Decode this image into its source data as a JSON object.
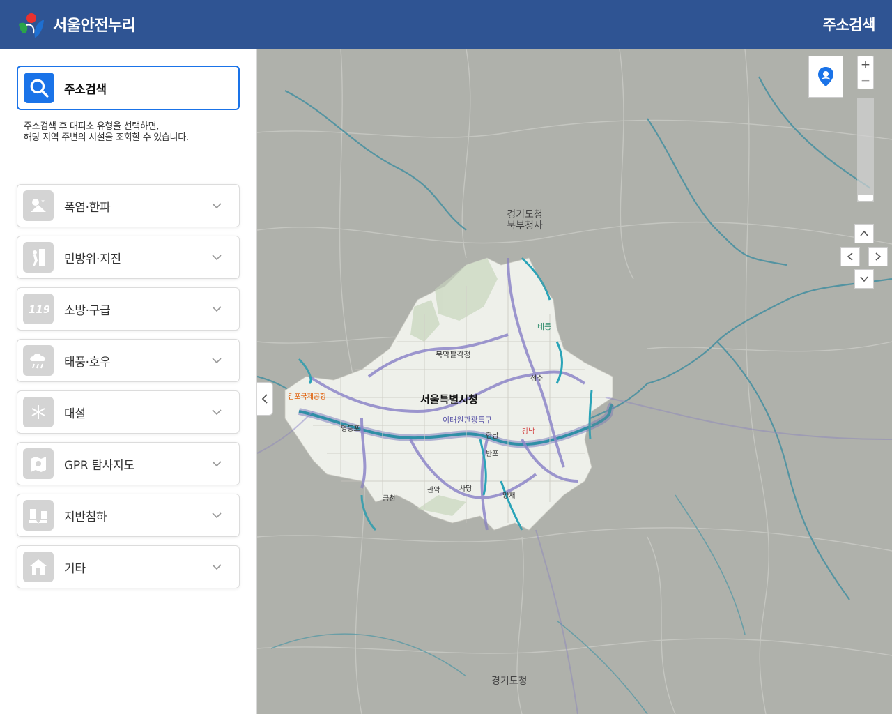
{
  "header": {
    "app_name": "서울안전누리",
    "page_title": "주소검색"
  },
  "search": {
    "label": "주소검색",
    "help_line1": "주소검색 후 대피소 유형을 선택하면,",
    "help_line2": "해당 지역 주변의 시설을 조회할 수 있습니다."
  },
  "categories": [
    {
      "label": "폭염·한파",
      "icon": "heatwave-coldwave-icon"
    },
    {
      "label": "민방위·지진",
      "icon": "civil-defense-earthquake-icon"
    },
    {
      "label": "소방·구급",
      "icon": "fire-119-icon"
    },
    {
      "label": "태풍·호우",
      "icon": "typhoon-rain-icon"
    },
    {
      "label": "대설",
      "icon": "snow-icon"
    },
    {
      "label": "GPR 탐사지도",
      "icon": "gpr-map-icon"
    },
    {
      "label": "지반침하",
      "icon": "ground-subsidence-icon"
    },
    {
      "label": "기타",
      "icon": "other-house-icon"
    }
  ],
  "map": {
    "labels": {
      "seoul_city_hall": "서울특별시청",
      "gyeonggi_north": "경기도청 북부청사",
      "gyeonggi": "경기도청",
      "bukhansan": "북악팔각정",
      "itaewon": "이태원관광특구",
      "gimpo_airport": "김포국제공항",
      "taereung": "태릉",
      "hannam": "한남",
      "banpo": "반포",
      "yangjae": "양재",
      "geumcheon": "금천",
      "gwanak": "관악",
      "sadang": "사당",
      "seongsu": "성수",
      "yeongdeungpo": "영등포",
      "gangnam": "강남"
    },
    "zoom_in": "+",
    "zoom_out": "−",
    "colors": {
      "water": "#2f8fa6",
      "seoul_fill": "#eef0ea",
      "highway": "#8d86c9",
      "outside": "#b9bbb5"
    }
  }
}
